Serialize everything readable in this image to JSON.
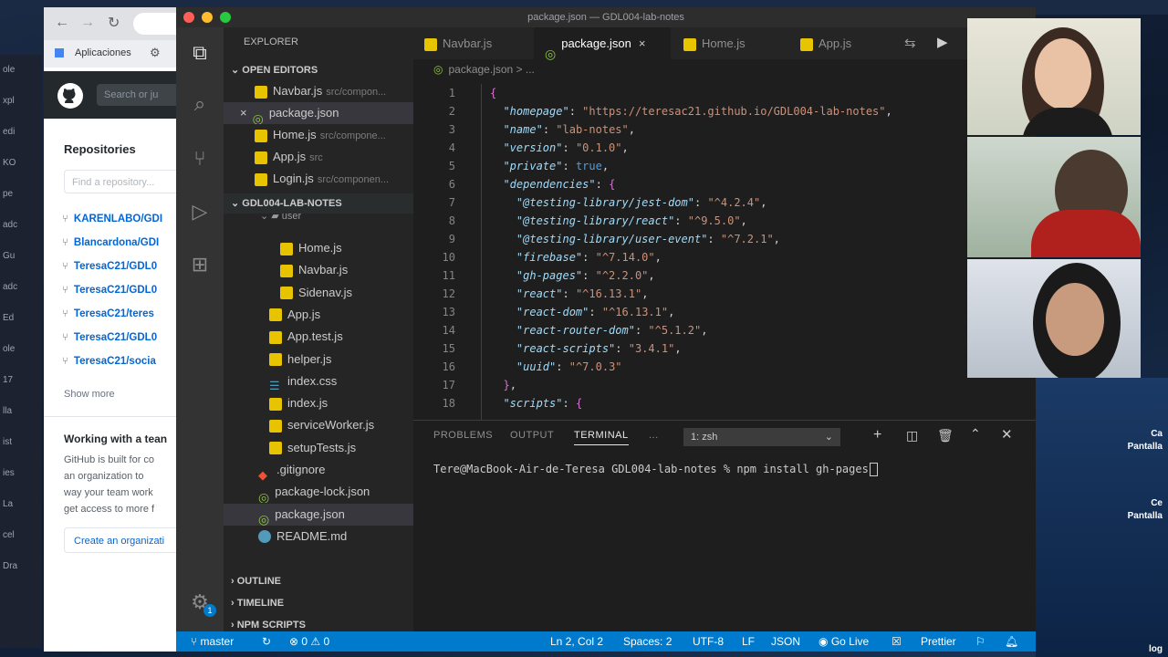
{
  "window_title": "package.json — GDL004-lab-notes",
  "chrome": {
    "bookmarks_label": "Aplicaciones",
    "search_placeholder": "Search or ju",
    "repositories_heading": "Repositories",
    "find_placeholder": "Find a repository...",
    "repos": [
      "KARENLABO/GDI",
      "Blancardona/GDI",
      "TeresaC21/GDL0",
      "TeresaC21/GDL0",
      "TeresaC21/teres",
      "TeresaC21/GDL0",
      "TeresaC21/socia"
    ],
    "show_more": "Show more",
    "working_title": "Working with a tean",
    "working_lines": [
      "GitHub is built for co",
      "an organization to",
      "way your team work",
      "get access to more f"
    ],
    "create_org": "Create an organizati"
  },
  "fringe_text": [
    "ole",
    "xpl",
    "edi",
    "KO",
    "pe",
    "adc",
    "Gu",
    "adc",
    "Ed",
    "ole",
    "17",
    "lla",
    "ist",
    "ies",
    "La",
    "cel",
    "Dra"
  ],
  "sidebar": {
    "explorer_title": "EXPLORER",
    "open_editors_title": "OPEN EDITORS",
    "open_editors": [
      {
        "name": "Navbar.js",
        "path": "src/compon...",
        "type": "js"
      },
      {
        "name": "package.json",
        "path": "",
        "type": "json",
        "close": "×"
      },
      {
        "name": "Home.js",
        "path": "src/compone...",
        "type": "js"
      },
      {
        "name": "App.js",
        "path": "src",
        "type": "js"
      },
      {
        "name": "Login.js",
        "path": "src/componen...",
        "type": "js"
      }
    ],
    "project_title": "GDL004-LAB-NOTES",
    "partial_folder": "user",
    "files": [
      {
        "name": "Home.js",
        "type": "js",
        "indent": 2
      },
      {
        "name": "Navbar.js",
        "type": "js",
        "indent": 2
      },
      {
        "name": "Sidenav.js",
        "type": "js",
        "indent": 2
      },
      {
        "name": "App.js",
        "type": "js",
        "indent": 1
      },
      {
        "name": "App.test.js",
        "type": "js",
        "indent": 1
      },
      {
        "name": "helper.js",
        "type": "js",
        "indent": 1
      },
      {
        "name": "index.css",
        "type": "css",
        "indent": 1
      },
      {
        "name": "index.js",
        "type": "js",
        "indent": 1
      },
      {
        "name": "serviceWorker.js",
        "type": "js",
        "indent": 1
      },
      {
        "name": "setupTests.js",
        "type": "js",
        "indent": 1
      },
      {
        "name": ".gitignore",
        "type": "git",
        "indent": 0
      },
      {
        "name": "package-lock.json",
        "type": "json",
        "indent": 0
      },
      {
        "name": "package.json",
        "type": "json",
        "indent": 0
      },
      {
        "name": "README.md",
        "type": "info",
        "indent": 0
      }
    ],
    "outline": "OUTLINE",
    "timeline": "TIMELINE",
    "npm_scripts": "NPM SCRIPTS"
  },
  "tabs": [
    "Navbar.js",
    "package.json",
    "Home.js",
    "App.js"
  ],
  "active_tab_close": "×",
  "breadcrumb": "package.json > ...",
  "code_lines": [
    [
      {
        "t": "{",
        "c": "br"
      }
    ],
    [
      {
        "t": "  "
      },
      {
        "t": "\"homepage\"",
        "c": "k"
      },
      {
        "t": ": "
      },
      {
        "t": "\"https://teresac21.github.io/GDL004-lab-notes\"",
        "c": "s"
      },
      {
        "t": ","
      }
    ],
    [
      {
        "t": "  "
      },
      {
        "t": "\"name\"",
        "c": "k"
      },
      {
        "t": ": "
      },
      {
        "t": "\"lab-notes\"",
        "c": "s"
      },
      {
        "t": ","
      }
    ],
    [
      {
        "t": "  "
      },
      {
        "t": "\"version\"",
        "c": "k"
      },
      {
        "t": ": "
      },
      {
        "t": "\"0.1.0\"",
        "c": "s"
      },
      {
        "t": ","
      }
    ],
    [
      {
        "t": "  "
      },
      {
        "t": "\"private\"",
        "c": "k"
      },
      {
        "t": ": "
      },
      {
        "t": "true",
        "c": "b"
      },
      {
        "t": ","
      }
    ],
    [
      {
        "t": "  "
      },
      {
        "t": "\"dependencies\"",
        "c": "k"
      },
      {
        "t": ": "
      },
      {
        "t": "{",
        "c": "br"
      }
    ],
    [
      {
        "t": "    "
      },
      {
        "t": "\"@testing-library/jest-dom\"",
        "c": "k"
      },
      {
        "t": ": "
      },
      {
        "t": "\"^4.2.4\"",
        "c": "s"
      },
      {
        "t": ","
      }
    ],
    [
      {
        "t": "    "
      },
      {
        "t": "\"@testing-library/react\"",
        "c": "k"
      },
      {
        "t": ": "
      },
      {
        "t": "\"^9.5.0\"",
        "c": "s"
      },
      {
        "t": ","
      }
    ],
    [
      {
        "t": "    "
      },
      {
        "t": "\"@testing-library/user-event\"",
        "c": "k"
      },
      {
        "t": ": "
      },
      {
        "t": "\"^7.2.1\"",
        "c": "s"
      },
      {
        "t": ","
      }
    ],
    [
      {
        "t": "    "
      },
      {
        "t": "\"firebase\"",
        "c": "k"
      },
      {
        "t": ": "
      },
      {
        "t": "\"^7.14.0\"",
        "c": "s"
      },
      {
        "t": ","
      }
    ],
    [
      {
        "t": "    "
      },
      {
        "t": "\"gh-pages\"",
        "c": "k"
      },
      {
        "t": ": "
      },
      {
        "t": "\"^2.2.0\"",
        "c": "s"
      },
      {
        "t": ","
      }
    ],
    [
      {
        "t": "    "
      },
      {
        "t": "\"react\"",
        "c": "k"
      },
      {
        "t": ": "
      },
      {
        "t": "\"^16.13.1\"",
        "c": "s"
      },
      {
        "t": ","
      }
    ],
    [
      {
        "t": "    "
      },
      {
        "t": "\"react-dom\"",
        "c": "k"
      },
      {
        "t": ": "
      },
      {
        "t": "\"^16.13.1\"",
        "c": "s"
      },
      {
        "t": ","
      }
    ],
    [
      {
        "t": "    "
      },
      {
        "t": "\"react-router-dom\"",
        "c": "k"
      },
      {
        "t": ": "
      },
      {
        "t": "\"^5.1.2\"",
        "c": "s"
      },
      {
        "t": ","
      }
    ],
    [
      {
        "t": "    "
      },
      {
        "t": "\"react-scripts\"",
        "c": "k"
      },
      {
        "t": ": "
      },
      {
        "t": "\"3.4.1\"",
        "c": "s"
      },
      {
        "t": ","
      }
    ],
    [
      {
        "t": "    "
      },
      {
        "t": "\"uuid\"",
        "c": "k"
      },
      {
        "t": ": "
      },
      {
        "t": "\"^7.0.3\"",
        "c": "s"
      }
    ],
    [
      {
        "t": "  "
      },
      {
        "t": "}",
        "c": "br"
      },
      {
        "t": ","
      }
    ],
    [
      {
        "t": "  "
      },
      {
        "t": "\"scripts\"",
        "c": "k"
      },
      {
        "t": ": "
      },
      {
        "t": "{",
        "c": "br"
      }
    ]
  ],
  "panel": {
    "tabs": [
      "PROBLEMS",
      "OUTPUT",
      "TERMINAL",
      "..."
    ],
    "terminal_select": "1: zsh",
    "terminal_line": "Tere@MacBook-Air-de-Teresa GDL004-lab-notes % npm install gh-pages"
  },
  "status": {
    "branch": "master",
    "problems": "⊗ 0 ⚠ 0",
    "position": "Ln 2, Col 2",
    "spaces": "Spaces: 2",
    "encoding": "UTF-8",
    "eol": "LF",
    "language": "JSON",
    "golive": "Go Live",
    "prettier": "Prettier"
  },
  "right_labels": [
    "Ca",
    "Pantalla",
    "Ce",
    "Pantalla",
    "log"
  ]
}
